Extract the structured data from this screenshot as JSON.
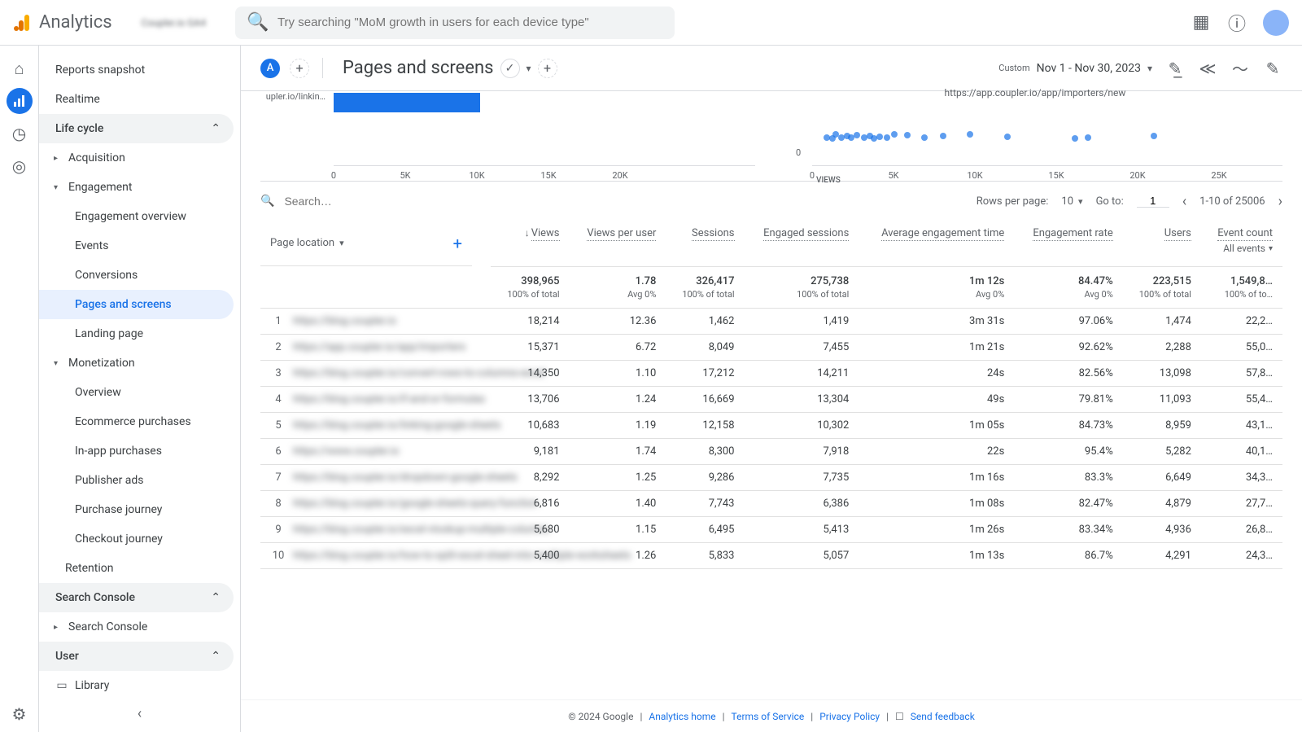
{
  "app": {
    "name": "Analytics",
    "account": "Coupler.io GA4"
  },
  "search": {
    "placeholder": "Try searching \"MoM growth in users for each device type\""
  },
  "rail": [
    {
      "id": "home",
      "glyph": "⌂"
    },
    {
      "id": "reports",
      "glyph": "▮",
      "active": true
    },
    {
      "id": "explore",
      "glyph": "◔"
    },
    {
      "id": "advertising",
      "glyph": "◉"
    }
  ],
  "nav": {
    "top": [
      "Reports snapshot",
      "Realtime"
    ],
    "lifecycle": {
      "label": "Life cycle",
      "items": [
        {
          "label": "Acquisition",
          "expand": true
        },
        {
          "label": "Engagement",
          "expand": true,
          "open": true,
          "children": [
            "Engagement overview",
            "Events",
            "Conversions",
            "Pages and screens",
            "Landing page"
          ],
          "active_child": "Pages and screens"
        },
        {
          "label": "Monetization",
          "expand": true,
          "open": true,
          "children": [
            "Overview",
            "Ecommerce purchases",
            "In-app purchases",
            "Publisher ads",
            "Purchase journey",
            "Checkout journey"
          ]
        },
        {
          "label": "Retention"
        }
      ]
    },
    "search_console": {
      "label": "Search Console",
      "items": [
        "Search Console"
      ]
    },
    "user": {
      "label": "User"
    },
    "library": "Library"
  },
  "page": {
    "badge": "A",
    "title": "Pages and screens",
    "date_label": "Custom",
    "date_range": "Nov 1 - Nov 30, 2023"
  },
  "chart_data": [
    {
      "type": "bar",
      "orientation": "horizontal",
      "categories": [
        "upler.io/linkin…"
      ],
      "values": [
        10200
      ],
      "xlim": [
        0,
        20000
      ],
      "xticks": [
        0,
        "5K",
        "10K",
        "15K",
        "20K"
      ]
    },
    {
      "type": "scatter",
      "title": "https://app.coupler.io/app/importers/new",
      "xlabel": "VIEWS",
      "xticks": [
        0,
        "5K",
        "10K",
        "15K",
        "20K",
        "25K"
      ],
      "xlim": [
        0,
        25000
      ],
      "ylim": [
        0,
        100
      ],
      "points": [
        [
          600,
          30
        ],
        [
          900,
          28
        ],
        [
          1100,
          35
        ],
        [
          1400,
          30
        ],
        [
          1700,
          32
        ],
        [
          1900,
          29
        ],
        [
          2200,
          34
        ],
        [
          2600,
          30
        ],
        [
          2900,
          33
        ],
        [
          3100,
          28
        ],
        [
          3400,
          31
        ],
        [
          3800,
          29
        ],
        [
          4200,
          35
        ],
        [
          4900,
          34
        ],
        [
          5800,
          30
        ],
        [
          6800,
          32
        ],
        [
          8200,
          36
        ],
        [
          10200,
          31
        ],
        [
          13800,
          27
        ],
        [
          14500,
          30
        ],
        [
          18000,
          33
        ]
      ]
    }
  ],
  "table": {
    "search_placeholder": "Search…",
    "rows_per_page_label": "Rows per page:",
    "rows_per_page": "10",
    "goto_label": "Go to:",
    "goto_value": "1",
    "range": "1-10 of 25006",
    "dimension": "Page location",
    "columns": [
      {
        "label": "Views",
        "sort": true
      },
      {
        "label": "Views per user"
      },
      {
        "label": "Sessions"
      },
      {
        "label": "Engaged sessions"
      },
      {
        "label": "Average engagement time"
      },
      {
        "label": "Engagement rate"
      },
      {
        "label": "Users"
      },
      {
        "label": "Event count",
        "sub": "All events"
      }
    ],
    "totals": {
      "values": [
        "398,965",
        "1.78",
        "326,417",
        "275,738",
        "1m 12s",
        "84.47%",
        "223,515",
        "1,549,8…"
      ],
      "subs": [
        "100% of total",
        "Avg 0%",
        "100% of total",
        "100% of total",
        "Avg 0%",
        "Avg 0%",
        "100% of total",
        "100% of to…"
      ]
    },
    "rows": [
      {
        "i": 1,
        "page": "https://blog.coupler.io",
        "v": [
          "18,214",
          "12.36",
          "1,462",
          "1,419",
          "3m 31s",
          "97.06%",
          "1,474",
          "22,2…"
        ]
      },
      {
        "i": 2,
        "page": "https://app.coupler.io/app/importers",
        "v": [
          "15,371",
          "6.72",
          "8,049",
          "7,455",
          "1m 21s",
          "92.62%",
          "2,288",
          "55,0…"
        ]
      },
      {
        "i": 3,
        "page": "https://blog.coupler.io/convert-rows-to-columns-excel",
        "v": [
          "14,350",
          "1.10",
          "17,212",
          "14,211",
          "24s",
          "82.56%",
          "13,098",
          "57,8…"
        ]
      },
      {
        "i": 4,
        "page": "https://blog.coupler.io/if-and-or-formulas",
        "v": [
          "13,706",
          "1.24",
          "16,669",
          "13,304",
          "49s",
          "79.81%",
          "11,093",
          "55,4…"
        ]
      },
      {
        "i": 5,
        "page": "https://blog.coupler.io/linking-google-sheets",
        "v": [
          "10,683",
          "1.19",
          "12,158",
          "10,302",
          "1m 05s",
          "84.73%",
          "8,959",
          "43,1…"
        ]
      },
      {
        "i": 6,
        "page": "https://www.coupler.io",
        "v": [
          "9,181",
          "1.74",
          "8,300",
          "7,918",
          "22s",
          "95.4%",
          "5,282",
          "40,1…"
        ]
      },
      {
        "i": 7,
        "page": "https://blog.coupler.io/dropdown-google-sheets",
        "v": [
          "8,292",
          "1.25",
          "9,286",
          "7,735",
          "1m 16s",
          "83.3%",
          "6,649",
          "34,3…"
        ]
      },
      {
        "i": 8,
        "page": "https://blog.coupler.io/google-sheets-query-function",
        "v": [
          "6,816",
          "1.40",
          "7,743",
          "6,386",
          "1m 08s",
          "82.47%",
          "4,879",
          "27,7…"
        ]
      },
      {
        "i": 9,
        "page": "https://blog.coupler.io/excel-vlookup-multiple-columns",
        "v": [
          "5,680",
          "1.15",
          "6,495",
          "5,413",
          "1m 26s",
          "83.34%",
          "4,936",
          "26,8…"
        ]
      },
      {
        "i": 10,
        "page": "https://blog.coupler.io/how-to-split-excel-sheet-into-multiple-worksheets",
        "v": [
          "5,400",
          "1.26",
          "5,833",
          "5,057",
          "1m 13s",
          "86.7%",
          "4,291",
          "24,3…"
        ]
      }
    ]
  },
  "footer": {
    "copyright": "© 2024 Google",
    "links": [
      "Analytics home",
      "Terms of Service",
      "Privacy Policy"
    ],
    "feedback": "Send feedback"
  }
}
